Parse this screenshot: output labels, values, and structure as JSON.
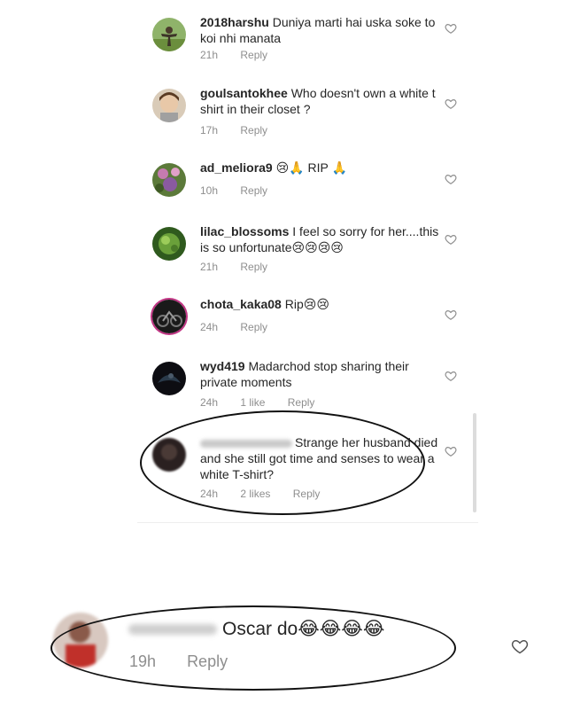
{
  "comments": [
    {
      "username": "2018harshu",
      "text": "Duniya marti hai uska soke to koi nhi manata",
      "time": "21h",
      "reply": "Reply"
    },
    {
      "username": "goulsantokhee",
      "text": "Who doesn't own a white t shirt in their closet ?",
      "time": "17h",
      "reply": "Reply"
    },
    {
      "username": "ad_meliora9",
      "text": "😢🙏 RIP 🙏",
      "time": "10h",
      "reply": "Reply"
    },
    {
      "username": "lilac_blossoms",
      "text": "I feel so sorry for her....this is so unfortunate😢😢😢😢",
      "time": "21h",
      "reply": "Reply"
    },
    {
      "username": "chota_kaka08",
      "text": "Rip😢😢",
      "time": "24h",
      "reply": "Reply"
    },
    {
      "username": "wyd419",
      "text": "Madarchod stop sharing their private moments",
      "time": "24h",
      "likes": "1 like",
      "reply": "Reply"
    },
    {
      "username": "",
      "text": "Strange her husband died and she still got time and senses to wear a white T-shirt?",
      "time": "24h",
      "likes": "2 likes",
      "reply": "Reply"
    }
  ],
  "highlight": {
    "username": "",
    "text": "Oscar do😂😂😂😂",
    "time": "19h",
    "reply": "Reply"
  },
  "colors": {
    "meta": "#8e8e8e",
    "text": "#262626",
    "story_ring": "#c13584"
  },
  "icons": {
    "like": "heart-outline-icon"
  }
}
